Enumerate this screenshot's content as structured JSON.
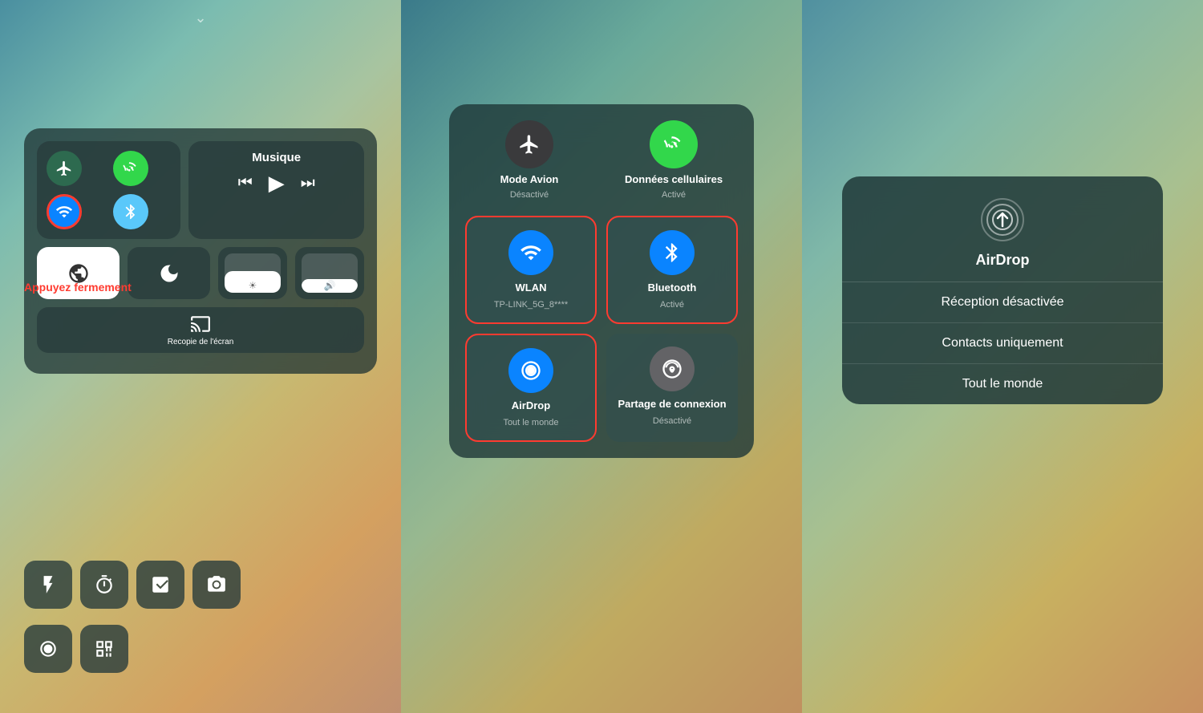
{
  "panel1": {
    "chevron": "⌄",
    "music_title": "Musique",
    "connectivity": {
      "airplane_label": "",
      "wifi_label": "",
      "cellular_label": "",
      "bluetooth_label": ""
    },
    "buttons": [
      {
        "id": "lock",
        "label": ""
      },
      {
        "id": "moon",
        "label": ""
      },
      {
        "id": "b3",
        "label": ""
      },
      {
        "id": "b4",
        "label": ""
      }
    ],
    "screen_mirror_label": "Recopie\nde l'écran",
    "bottom_icons": [
      "flashlight",
      "timer",
      "calculator",
      "camera"
    ],
    "extra_icons": [
      "record",
      "qr"
    ],
    "appuyez_label": "Appuyez fermement"
  },
  "panel2": {
    "mode_avion_label": "Mode Avion",
    "mode_avion_sub": "Désactivé",
    "cellular_label": "Données cellulaires",
    "cellular_sub": "Activé",
    "wlan_label": "WLAN",
    "wlan_sub": "TP-LINK_5G_8****",
    "bluetooth_label": "Bluetooth",
    "bluetooth_sub": "Activé",
    "airdrop_label": "AirDrop",
    "airdrop_sub": "Tout le monde",
    "hotspot_label": "Partage de connexion",
    "hotspot_sub": "Désactivé"
  },
  "panel3": {
    "title": "AirDrop",
    "options": [
      {
        "id": "reception-off",
        "label": "Réception désactivée"
      },
      {
        "id": "contacts-only",
        "label": "Contacts uniquement"
      },
      {
        "id": "everyone",
        "label": "Tout le monde"
      }
    ]
  },
  "colors": {
    "red_border": "#ff3b30",
    "blue": "#0a84ff",
    "green": "#32d74b",
    "dark_green": "#2d6a4f",
    "light_blue": "#5ac8fa"
  }
}
